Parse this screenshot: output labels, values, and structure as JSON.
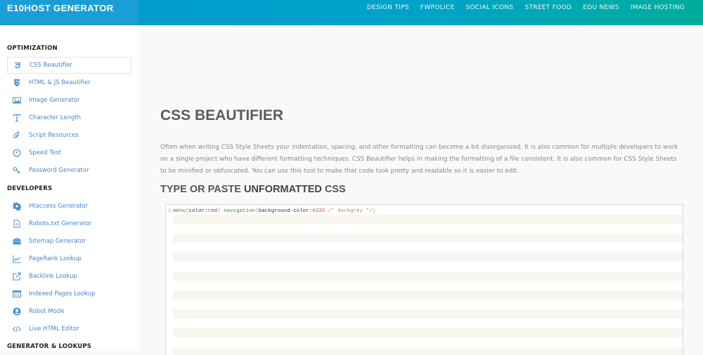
{
  "header": {
    "brand": "E10HOST GENERATOR",
    "nav": [
      "DESIGN TIPS",
      "FWPOLICE",
      "SOCIAL ICONS",
      "STREET FOOD",
      "EDU NEWS",
      "IMAGE HOSTING"
    ]
  },
  "sidebar": {
    "sections": [
      {
        "title": "OPTIMIZATION",
        "items": [
          {
            "label": "CSS Beautifier",
            "icon": "css3-icon",
            "active": true
          },
          {
            "label": "HTML & JS Beautifier",
            "icon": "html5-icon"
          },
          {
            "label": "Image Generator",
            "icon": "image-icon"
          },
          {
            "label": "Character Length",
            "icon": "text-icon"
          },
          {
            "label": "Script Resources",
            "icon": "paperclip-icon"
          },
          {
            "label": "Speed Test",
            "icon": "clock-icon"
          },
          {
            "label": "Password Generator",
            "icon": "key-icon"
          }
        ]
      },
      {
        "title": "DEVELOPERS",
        "items": [
          {
            "label": "Htaccess Generator",
            "icon": "gear-icon"
          },
          {
            "label": "Robots.txt Generator",
            "icon": "file-icon"
          },
          {
            "label": "Sitemap Generator",
            "icon": "briefcase-icon"
          },
          {
            "label": "PageRank Lookup",
            "icon": "line-chart-icon"
          },
          {
            "label": "Backlink Lookup",
            "icon": "external-link-icon"
          },
          {
            "label": "Indexed Pages Lookup",
            "icon": "browser-icon"
          },
          {
            "label": "Robot Mode",
            "icon": "user-circle-icon"
          },
          {
            "label": "Live HTML Editor",
            "icon": "code-icon"
          }
        ]
      },
      {
        "title": "GENERATOR & LOOKUPS",
        "items": []
      }
    ]
  },
  "main": {
    "title": "CSS BEAUTIFIER",
    "description": "Often when writing CSS Style Sheets your indentation, spacing, and other formatting can become a bit disorganized. It is also common for multiple developers to work on a single project who have different formatting techniques. CSS Beautifier helps in making the formatting of a file consistent. It is also common for CSS Style Sheets to be minified or obfuscated. You can use this tool to make that code look pretty and readable so it is easier to edit.",
    "subheading_pre": "TYPE OR PASTE ",
    "subheading_bold": "UNFORMATTED",
    "subheading_post": " CSS",
    "editor": {
      "line_number": "1",
      "tokens": {
        "sel1": "menu",
        "open1": "{",
        "prop1": "color:",
        "val1": "red",
        "close1": "}",
        "sel2": " navigation",
        "open2": "{",
        "prop2": "background-color:",
        "num2": "#333",
        "comment": " /* darkgrey */",
        "close2": "}"
      }
    }
  }
}
